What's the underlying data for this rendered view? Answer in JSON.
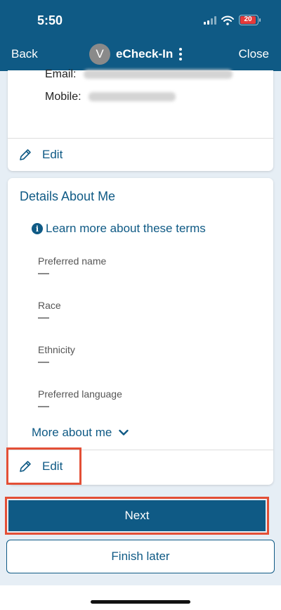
{
  "status_bar": {
    "time": "5:50",
    "battery": "20"
  },
  "nav": {
    "back": "Back",
    "avatar_initial": "V",
    "title": "eCheck-In",
    "close": "Close"
  },
  "contact": {
    "email_label": "Email:",
    "mobile_label": "Mobile:",
    "edit": "Edit"
  },
  "details": {
    "title": "Details About Me",
    "info_link": "Learn more about these terms",
    "info_icon": "i",
    "fields": [
      {
        "label": "Preferred name",
        "value": "—"
      },
      {
        "label": "Race",
        "value": "—"
      },
      {
        "label": "Ethnicity",
        "value": "—"
      },
      {
        "label": "Preferred language",
        "value": "—"
      }
    ],
    "more": "More about me",
    "edit": "Edit"
  },
  "actions": {
    "next": "Next",
    "finish_later": "Finish later"
  },
  "colors": {
    "brand": "#0f5a85",
    "highlight": "#e34f36",
    "battery_low": "#e63a3a"
  }
}
